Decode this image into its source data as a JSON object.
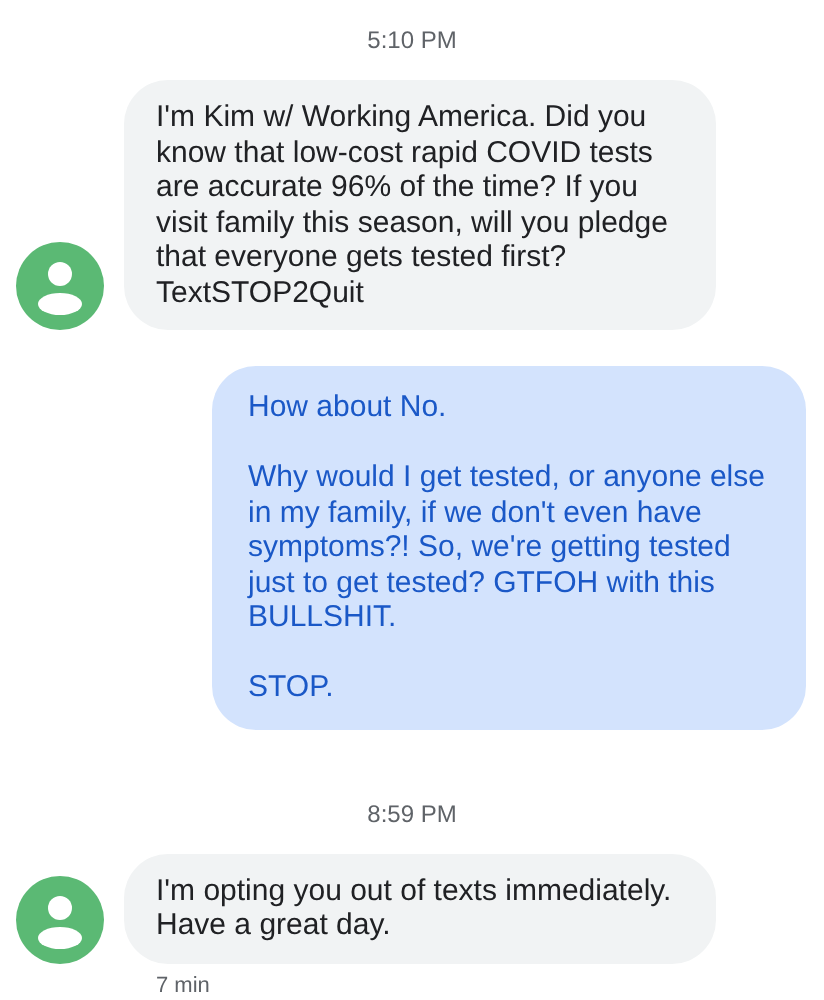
{
  "thread": [
    {
      "kind": "timestamp",
      "text": "5:10 PM"
    },
    {
      "kind": "incoming",
      "paragraphs": [
        "I'm Kim w/ Working America. Did you know that low-cost rapid COVID tests are accurate 96% of the time? If you visit family this season, will you pledge that everyone gets tested first? TextSTOP2Quit"
      ]
    },
    {
      "kind": "outgoing",
      "paragraphs": [
        "How about No.",
        "Why would I get tested, or anyone else in my family, if we don't even have symptoms?! So, we're getting tested just to get tested? GTFOH with this BULLSHIT.",
        "STOP."
      ]
    },
    {
      "kind": "timestamp",
      "text": "8:59 PM"
    },
    {
      "kind": "incoming",
      "paragraphs": [
        "I'm opting you out of texts immediately. Have a great day."
      ],
      "meta": "7 min"
    }
  ]
}
